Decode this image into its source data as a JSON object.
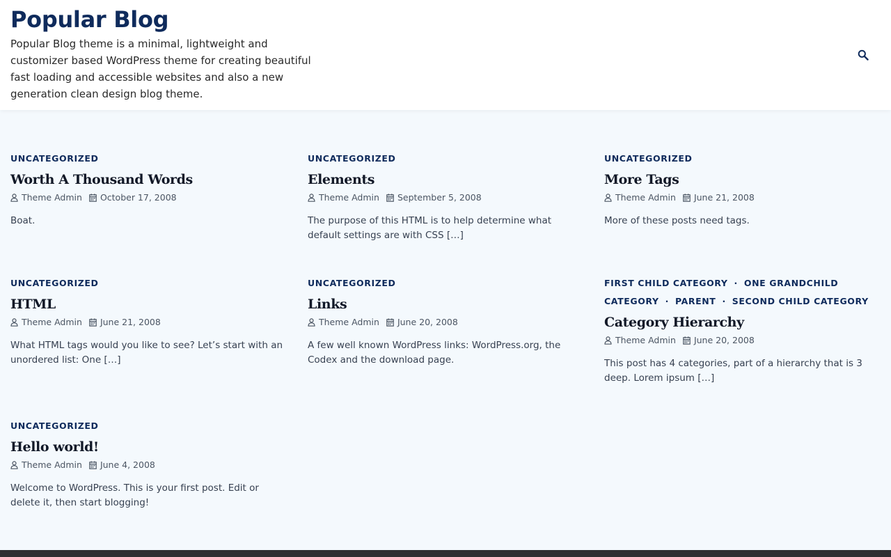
{
  "header": {
    "site_title": "Popular Blog",
    "site_description": "Popular Blog theme is a minimal, lightweight and customizer based WordPress theme for creating beautiful fast loading and accessible websites and also a new generation clean design blog theme."
  },
  "icons": {
    "search": "search-icon",
    "author": "user-icon",
    "date": "calendar-icon"
  },
  "colors": {
    "accent": "#0f2b5c",
    "background": "#f4f9fd",
    "header_bg": "#ffffff",
    "footer_bg": "#2f3033"
  },
  "posts": [
    {
      "categories": [
        "UNCATEGORIZED"
      ],
      "title": "Worth A Thousand Words",
      "author": "Theme Admin",
      "date": "October 17, 2008",
      "excerpt": "Boat."
    },
    {
      "categories": [
        "UNCATEGORIZED"
      ],
      "title": "Elements",
      "author": "Theme Admin",
      "date": "September 5, 2008",
      "excerpt": "The purpose of this HTML is to help determine what default settings are with CSS […]"
    },
    {
      "categories": [
        "UNCATEGORIZED"
      ],
      "title": "More Tags",
      "author": "Theme Admin",
      "date": "June 21, 2008",
      "excerpt": "More of these posts need tags."
    },
    {
      "categories": [
        "UNCATEGORIZED"
      ],
      "title": "HTML",
      "author": "Theme Admin",
      "date": "June 21, 2008",
      "excerpt": "What HTML tags would you like to see? Let’s start with an unordered list: One […]"
    },
    {
      "categories": [
        "UNCATEGORIZED"
      ],
      "title": "Links",
      "author": "Theme Admin",
      "date": "June 20, 2008",
      "excerpt": "A few well known WordPress links: WordPress.org, the Codex and the download page."
    },
    {
      "categories": [
        "FIRST CHILD CATEGORY",
        "ONE GRANDCHILD CATEGORY",
        "PARENT",
        "SECOND CHILD CATEGORY"
      ],
      "title": "Category Hierarchy",
      "author": "Theme Admin",
      "date": "June 20, 2008",
      "excerpt": "This post has 4 categories, part of a hierarchy that is 3 deep. Lorem ipsum […]"
    },
    {
      "categories": [
        "UNCATEGORIZED"
      ],
      "title": "Hello world!",
      "author": "Theme Admin",
      "date": "June 4, 2008",
      "excerpt": "Welcome to WordPress. This is your first post. Edit or delete it, then start blogging!"
    }
  ]
}
